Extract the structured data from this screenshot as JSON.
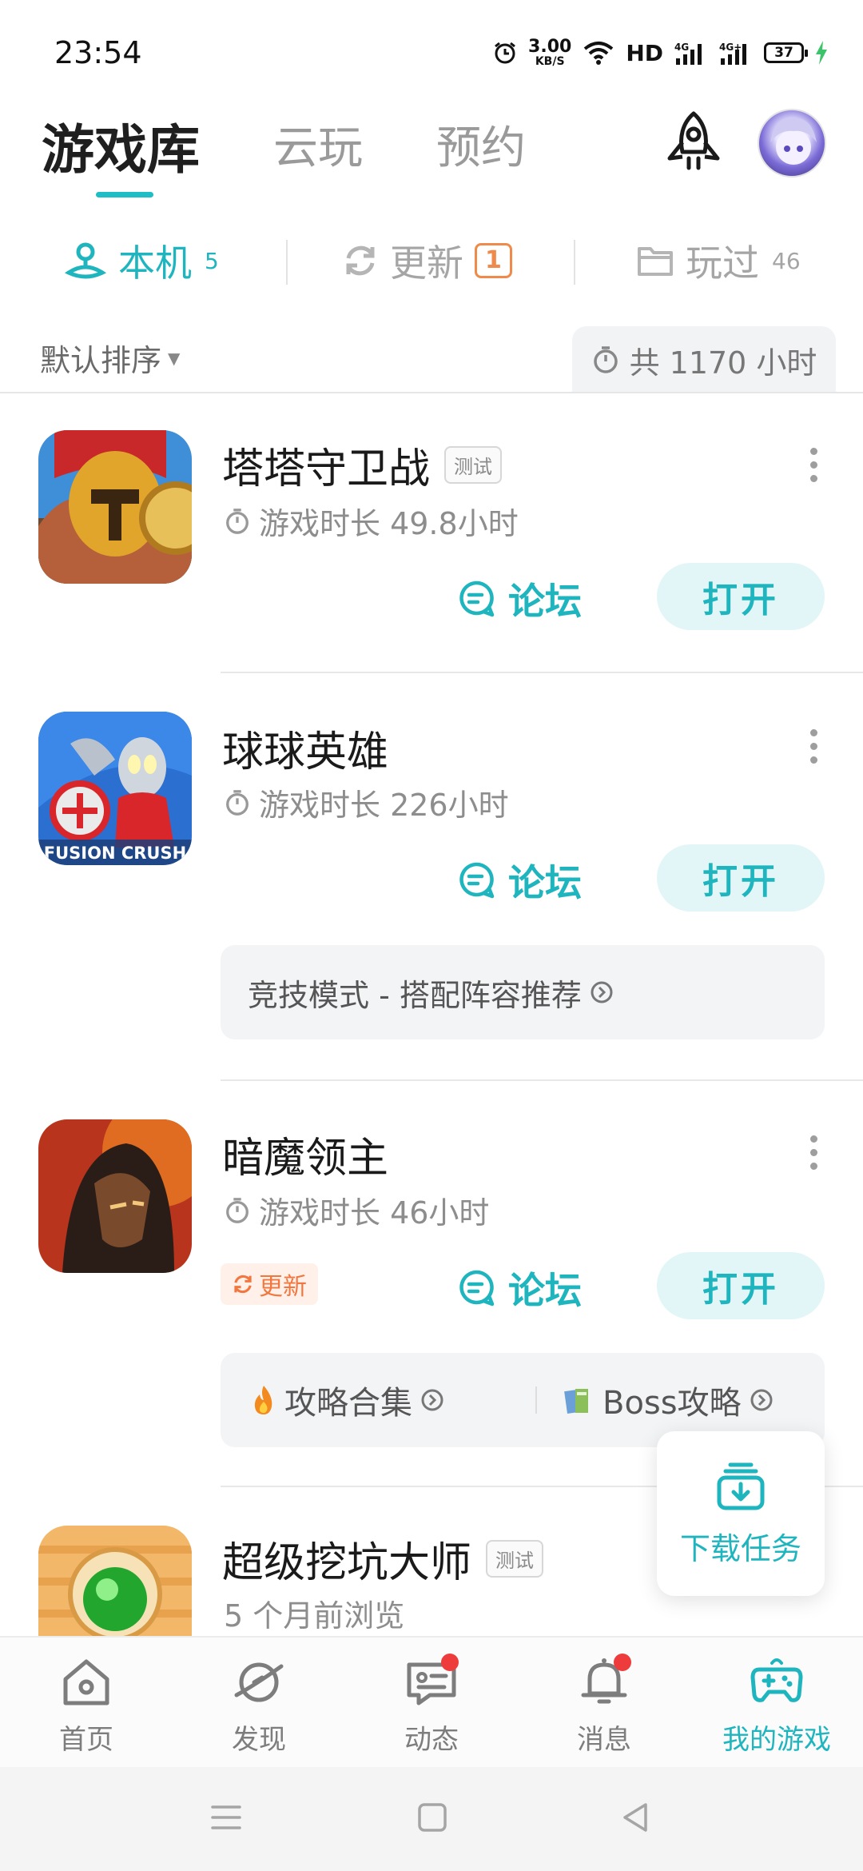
{
  "status_bar": {
    "time": "23:54",
    "net_speed_value": "3.00",
    "net_speed_unit": "KB/S",
    "hd_label": "HD",
    "signal_1": "4G",
    "signal_2": "4G+",
    "battery": "37"
  },
  "header": {
    "tabs": [
      {
        "label": "游戏库",
        "active": true
      },
      {
        "label": "云玩",
        "active": false
      },
      {
        "label": "预约",
        "active": false
      }
    ],
    "rocket_icon": "rocket-icon",
    "avatar_icon": "user-avatar"
  },
  "sub_tabs": [
    {
      "label": "本机",
      "count": "5",
      "icon": "local-device-icon",
      "active": true
    },
    {
      "label": "更新",
      "badge": "1",
      "icon": "refresh-icon",
      "active": false
    },
    {
      "label": "玩过",
      "count": "46",
      "icon": "folder-icon",
      "active": false
    }
  ],
  "sort": {
    "label": "默认排序",
    "total_time": "共 1170 小时"
  },
  "games": [
    {
      "name": "塔塔守卫战",
      "tag": "测试",
      "play_time": "游戏时长 49.8小时",
      "forum_label": "论坛",
      "open_label": "打开"
    },
    {
      "name": "球球英雄",
      "play_time": "游戏时长 226小时",
      "forum_label": "论坛",
      "open_label": "打开",
      "icon_caption": "FUSION CRUSH",
      "recommend": "竞技模式 - 搭配阵容推荐"
    },
    {
      "name": "暗魔领主",
      "play_time": "游戏时长 46小时",
      "forum_label": "论坛",
      "open_label": "打开",
      "update_label": "更新",
      "guides": [
        {
          "label": "攻略合集",
          "icon": "fire-icon"
        },
        {
          "label": "Boss攻略",
          "icon": "books-icon"
        }
      ]
    },
    {
      "name": "超级挖坑大师",
      "tag": "测试",
      "sub_text": "5 个月前浏览"
    }
  ],
  "download_task": {
    "label": "下载任务"
  },
  "bottom_nav": [
    {
      "label": "首页",
      "icon": "home-icon",
      "active": false
    },
    {
      "label": "发现",
      "icon": "planet-icon",
      "active": false
    },
    {
      "label": "动态",
      "icon": "message-bubble-icon",
      "active": false,
      "dot": true
    },
    {
      "label": "消息",
      "icon": "bell-icon",
      "active": false,
      "dot": true
    },
    {
      "label": "我的游戏",
      "icon": "gamepad-icon",
      "active": true
    }
  ],
  "colors": {
    "accent": "#1fb5bf",
    "update_orange": "#f08a4b",
    "badge_red": "#ee3b3b"
  }
}
